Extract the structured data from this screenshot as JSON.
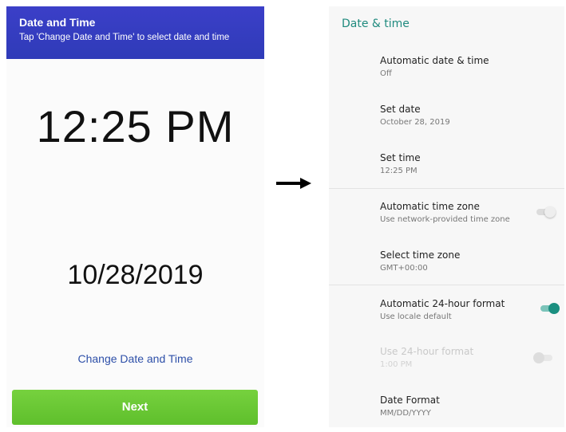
{
  "left": {
    "header_title": "Date and Time",
    "header_subtitle": "Tap 'Change Date and Time' to select date and time",
    "time": "12:25 PM",
    "date": "10/28/2019",
    "change_link": "Change Date and Time",
    "next_button": "Next"
  },
  "right": {
    "title": "Date & time",
    "items": [
      {
        "label": "Automatic date & time",
        "summary": "Off"
      },
      {
        "label": "Set date",
        "summary": "October 28, 2019"
      },
      {
        "label": "Set time",
        "summary": "12:25 PM"
      },
      {
        "label": "Automatic time zone",
        "summary": "Use network-provided time zone",
        "toggle": "off"
      },
      {
        "label": "Select time zone",
        "summary": "GMT+00:00"
      },
      {
        "label": "Automatic 24-hour format",
        "summary": "Use locale default",
        "toggle": "on"
      },
      {
        "label": "Use 24-hour format",
        "summary": "1:00 PM",
        "toggle": "disabled"
      },
      {
        "label": "Date Format",
        "summary": "MM/DD/YYYY"
      }
    ]
  },
  "colors": {
    "header_blue": "#2f3bb8",
    "next_green": "#5fbf2c",
    "accent_teal": "#1f8a7e",
    "link_blue": "#2d4fa8"
  },
  "icons": {
    "arrow": "arrow-right-icon"
  }
}
